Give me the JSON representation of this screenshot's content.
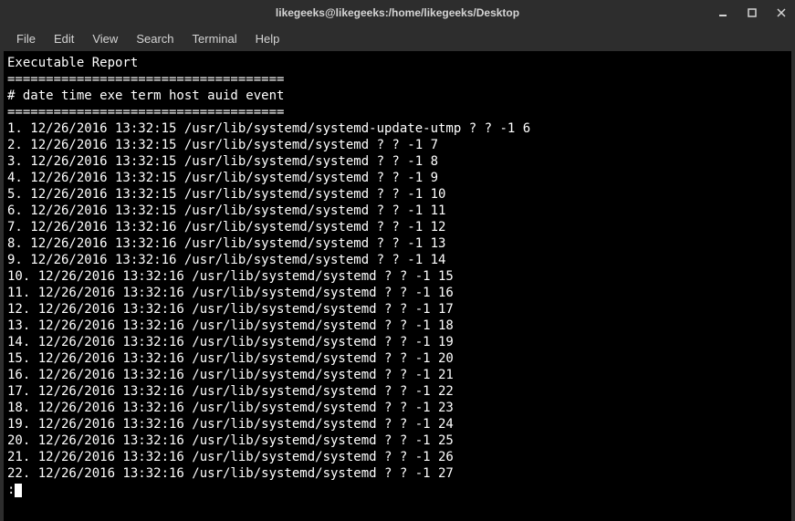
{
  "window": {
    "title": "likegeeks@likegeeks:/home/likegeeks/Desktop"
  },
  "menubar": {
    "items": [
      "File",
      "Edit",
      "View",
      "Search",
      "Terminal",
      "Help"
    ]
  },
  "terminal": {
    "header_title": "Executable Report",
    "separator": "====================================",
    "columns_line": "# date time exe term host auid event",
    "rows": [
      {
        "n": "1.",
        "date": "12/26/2016",
        "time": "13:32:15",
        "exe": "/usr/lib/systemd/systemd-update-utmp",
        "term": "?",
        "host": "?",
        "auid": "-1",
        "event": "6"
      },
      {
        "n": "2.",
        "date": "12/26/2016",
        "time": "13:32:15",
        "exe": "/usr/lib/systemd/systemd",
        "term": "?",
        "host": "?",
        "auid": "-1",
        "event": "7"
      },
      {
        "n": "3.",
        "date": "12/26/2016",
        "time": "13:32:15",
        "exe": "/usr/lib/systemd/systemd",
        "term": "?",
        "host": "?",
        "auid": "-1",
        "event": "8"
      },
      {
        "n": "4.",
        "date": "12/26/2016",
        "time": "13:32:15",
        "exe": "/usr/lib/systemd/systemd",
        "term": "?",
        "host": "?",
        "auid": "-1",
        "event": "9"
      },
      {
        "n": "5.",
        "date": "12/26/2016",
        "time": "13:32:15",
        "exe": "/usr/lib/systemd/systemd",
        "term": "?",
        "host": "?",
        "auid": "-1",
        "event": "10"
      },
      {
        "n": "6.",
        "date": "12/26/2016",
        "time": "13:32:15",
        "exe": "/usr/lib/systemd/systemd",
        "term": "?",
        "host": "?",
        "auid": "-1",
        "event": "11"
      },
      {
        "n": "7.",
        "date": "12/26/2016",
        "time": "13:32:16",
        "exe": "/usr/lib/systemd/systemd",
        "term": "?",
        "host": "?",
        "auid": "-1",
        "event": "12"
      },
      {
        "n": "8.",
        "date": "12/26/2016",
        "time": "13:32:16",
        "exe": "/usr/lib/systemd/systemd",
        "term": "?",
        "host": "?",
        "auid": "-1",
        "event": "13"
      },
      {
        "n": "9.",
        "date": "12/26/2016",
        "time": "13:32:16",
        "exe": "/usr/lib/systemd/systemd",
        "term": "?",
        "host": "?",
        "auid": "-1",
        "event": "14"
      },
      {
        "n": "10.",
        "date": "12/26/2016",
        "time": "13:32:16",
        "exe": "/usr/lib/systemd/systemd",
        "term": "?",
        "host": "?",
        "auid": "-1",
        "event": "15"
      },
      {
        "n": "11.",
        "date": "12/26/2016",
        "time": "13:32:16",
        "exe": "/usr/lib/systemd/systemd",
        "term": "?",
        "host": "?",
        "auid": "-1",
        "event": "16"
      },
      {
        "n": "12.",
        "date": "12/26/2016",
        "time": "13:32:16",
        "exe": "/usr/lib/systemd/systemd",
        "term": "?",
        "host": "?",
        "auid": "-1",
        "event": "17"
      },
      {
        "n": "13.",
        "date": "12/26/2016",
        "time": "13:32:16",
        "exe": "/usr/lib/systemd/systemd",
        "term": "?",
        "host": "?",
        "auid": "-1",
        "event": "18"
      },
      {
        "n": "14.",
        "date": "12/26/2016",
        "time": "13:32:16",
        "exe": "/usr/lib/systemd/systemd",
        "term": "?",
        "host": "?",
        "auid": "-1",
        "event": "19"
      },
      {
        "n": "15.",
        "date": "12/26/2016",
        "time": "13:32:16",
        "exe": "/usr/lib/systemd/systemd",
        "term": "?",
        "host": "?",
        "auid": "-1",
        "event": "20"
      },
      {
        "n": "16.",
        "date": "12/26/2016",
        "time": "13:32:16",
        "exe": "/usr/lib/systemd/systemd",
        "term": "?",
        "host": "?",
        "auid": "-1",
        "event": "21"
      },
      {
        "n": "17.",
        "date": "12/26/2016",
        "time": "13:32:16",
        "exe": "/usr/lib/systemd/systemd",
        "term": "?",
        "host": "?",
        "auid": "-1",
        "event": "22"
      },
      {
        "n": "18.",
        "date": "12/26/2016",
        "time": "13:32:16",
        "exe": "/usr/lib/systemd/systemd",
        "term": "?",
        "host": "?",
        "auid": "-1",
        "event": "23"
      },
      {
        "n": "19.",
        "date": "12/26/2016",
        "time": "13:32:16",
        "exe": "/usr/lib/systemd/systemd",
        "term": "?",
        "host": "?",
        "auid": "-1",
        "event": "24"
      },
      {
        "n": "20.",
        "date": "12/26/2016",
        "time": "13:32:16",
        "exe": "/usr/lib/systemd/systemd",
        "term": "?",
        "host": "?",
        "auid": "-1",
        "event": "25"
      },
      {
        "n": "21.",
        "date": "12/26/2016",
        "time": "13:32:16",
        "exe": "/usr/lib/systemd/systemd",
        "term": "?",
        "host": "?",
        "auid": "-1",
        "event": "26"
      },
      {
        "n": "22.",
        "date": "12/26/2016",
        "time": "13:32:16",
        "exe": "/usr/lib/systemd/systemd",
        "term": "?",
        "host": "?",
        "auid": "-1",
        "event": "27"
      }
    ],
    "prompt": ":"
  }
}
